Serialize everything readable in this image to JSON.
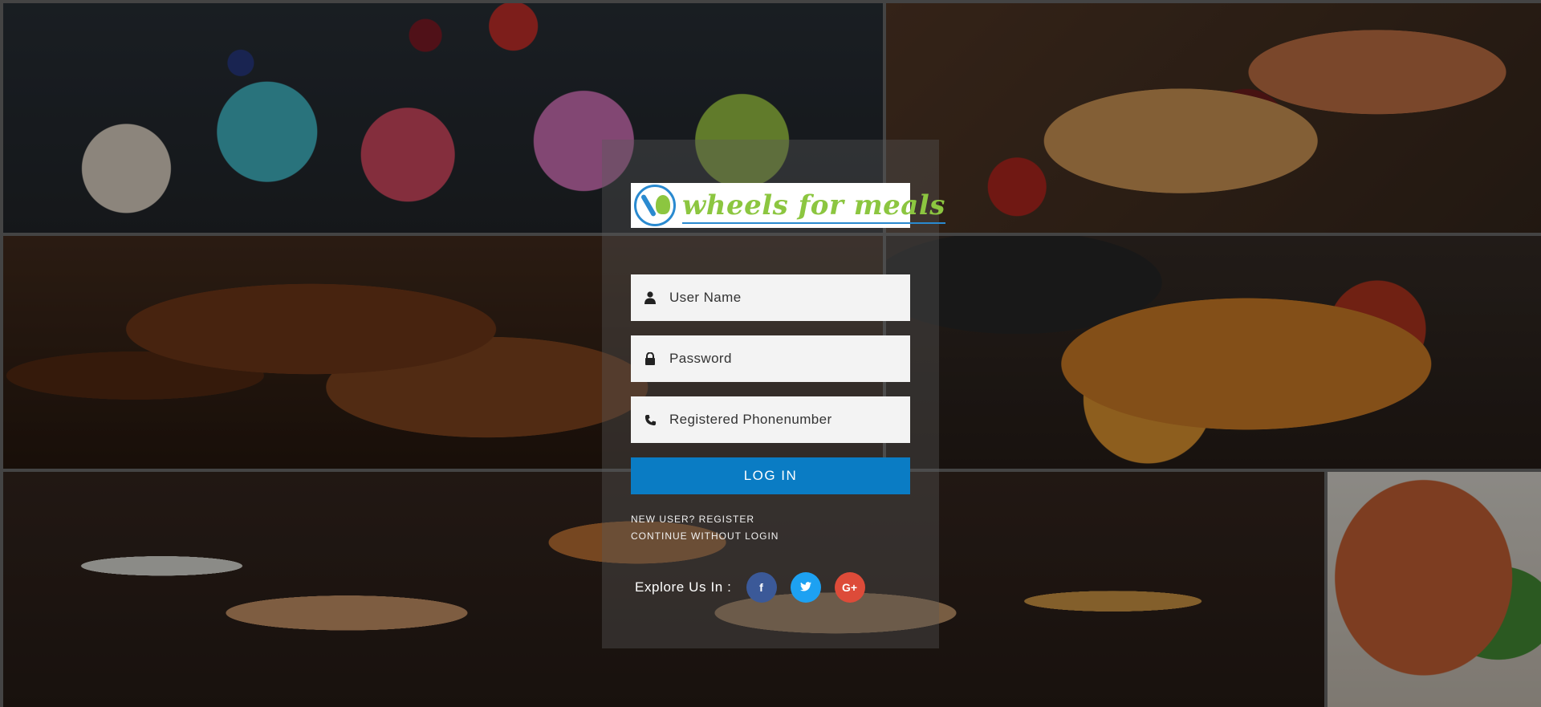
{
  "brand": {
    "logo_text": "wheels for meals"
  },
  "login_form": {
    "username_placeholder": "User Name",
    "password_placeholder": "Password",
    "phone_placeholder": "Registered Phonenumber",
    "login_label": "LOG IN"
  },
  "links": {
    "register": "NEW USER? REGISTER",
    "continue": "CONTINUE WITHOUT LOGIN"
  },
  "social": {
    "label": "Explore Us In :",
    "facebook_glyph": "f",
    "google_glyph": "G+"
  },
  "icons": [
    "user-icon",
    "lock-icon",
    "phone-icon",
    "facebook-icon",
    "twitter-icon",
    "google-plus-icon"
  ],
  "colors": {
    "primary_button": "#0a7cc4",
    "logo_green": "#8cc640",
    "logo_blue": "#2a8ad0",
    "facebook": "#3b5998",
    "twitter": "#1da1f2",
    "google_plus": "#dd4b39"
  }
}
